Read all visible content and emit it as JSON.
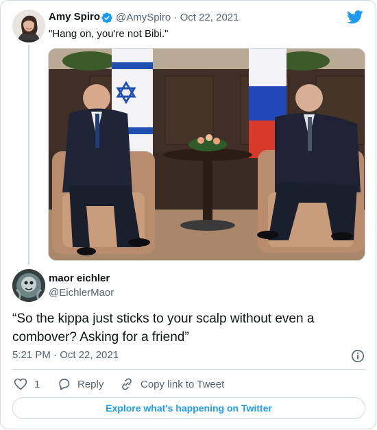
{
  "quoted_tweet": {
    "author_name": "Amy Spiro",
    "author_handle_date": "@AmySpiro · Oct 22, 2021",
    "text": "\"Hang on, you're not Bibi.\""
  },
  "tweet": {
    "author_name": "maor eichler",
    "author_handle": "@EichlerMaor",
    "text": "“So the kippa just sticks to your scalp without even a combover? Asking for a friend”",
    "timestamp": "5:21 PM · Oct 22, 2021"
  },
  "actions": {
    "like_count": "1",
    "reply_label": "Reply",
    "copy_link_label": "Copy link to Tweet"
  },
  "explore_label": "Explore what's happening on Twitter",
  "colors": {
    "twitter_blue": "#1d9bf0",
    "secondary_text": "#536471",
    "border": "#cfd9de"
  },
  "icons": [
    "twitter-bird-icon",
    "verified-badge-icon",
    "info-icon",
    "heart-icon",
    "reply-icon",
    "link-icon"
  ]
}
